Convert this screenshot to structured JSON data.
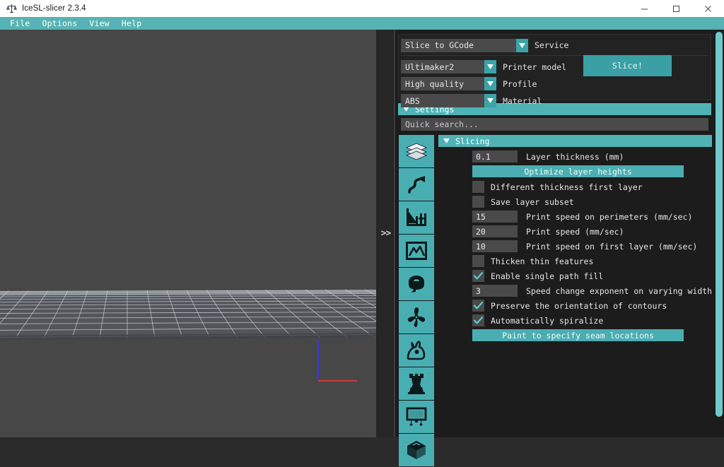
{
  "window": {
    "title": "IceSL-slicer 2.3.4",
    "icon": "icesl-logo-icon",
    "controls": [
      {
        "name": "minimize-button",
        "glyph": "minimize"
      },
      {
        "name": "maximize-button",
        "glyph": "maximize"
      },
      {
        "name": "close-button",
        "glyph": "close"
      }
    ]
  },
  "menubar": {
    "items": [
      {
        "label": "File"
      },
      {
        "label": "Options"
      },
      {
        "label": "View"
      },
      {
        "label": "Help"
      }
    ]
  },
  "viewport": {
    "name": "3d-build-plate-viewport",
    "axis_z_color": "#3a3ad0",
    "axis_x_color": "#d03a3a",
    "background": "#474747",
    "grid_color": "#c8cdd6"
  },
  "splitter": {
    "expand_label": ">>"
  },
  "service_panel": {
    "service": {
      "value": "Slice to GCode",
      "label": "Service"
    },
    "printer_model": {
      "value": "Ultimaker2",
      "label": "Printer model"
    },
    "profile": {
      "value": "High quality",
      "label": "Profile"
    },
    "material": {
      "value": "ABS",
      "label": "Material"
    },
    "slice_button": "Slice!"
  },
  "settings": {
    "header": "Settings",
    "search_placeholder": "Quick search...",
    "search_value": "",
    "icon_rail": [
      {
        "name": "layers-icon",
        "title": "Slicing"
      },
      {
        "name": "path-arrow-icon",
        "title": "Paths"
      },
      {
        "name": "support-icon",
        "title": "Support"
      },
      {
        "name": "bridge-icon",
        "title": "Bridges"
      },
      {
        "name": "filament-spool-icon",
        "title": "Extruder"
      },
      {
        "name": "cooling-fan-icon",
        "title": "Cooling"
      },
      {
        "name": "rabbit-speed-icon",
        "title": "Speed"
      },
      {
        "name": "rook-tower-icon",
        "title": "Tower"
      },
      {
        "name": "printer-display-icon",
        "title": "Printer"
      },
      {
        "name": "cube-box-icon",
        "title": "Advanced"
      }
    ],
    "slicing": {
      "header": "Slicing",
      "rows": [
        {
          "type": "number",
          "value": "0.1",
          "label": "Layer thickness (mm)"
        },
        {
          "type": "button",
          "label": "Optimize layer heights"
        },
        {
          "type": "checkbox",
          "checked": false,
          "label": "Different thickness first layer"
        },
        {
          "type": "checkbox",
          "checked": false,
          "label": "Save layer subset"
        },
        {
          "type": "number",
          "value": "15",
          "label": "Print speed on perimeters (mm/sec)"
        },
        {
          "type": "number",
          "value": "20",
          "label": "Print speed (mm/sec)"
        },
        {
          "type": "number",
          "value": "10",
          "label": "Print speed on first layer (mm/sec)"
        },
        {
          "type": "checkbox",
          "checked": false,
          "label": "Thicken thin features"
        },
        {
          "type": "checkbox",
          "checked": true,
          "label": "Enable single path fill"
        },
        {
          "type": "number",
          "value": "3",
          "label": "Speed change exponent on varying width"
        },
        {
          "type": "checkbox",
          "checked": true,
          "label": "Preserve the orientation of contours"
        },
        {
          "type": "checkbox",
          "checked": true,
          "label": "Automatically spiralize"
        },
        {
          "type": "button",
          "label": "Paint to specify seam locations"
        }
      ]
    }
  },
  "colors": {
    "accent": "#4fb3b6",
    "menu_bar": "#57b3b3",
    "panel_bg": "#1c1c1c",
    "field_bg": "#4a4a4a",
    "slice_button": "#3aa0a5",
    "scrollbar": "#6fc9cc"
  }
}
